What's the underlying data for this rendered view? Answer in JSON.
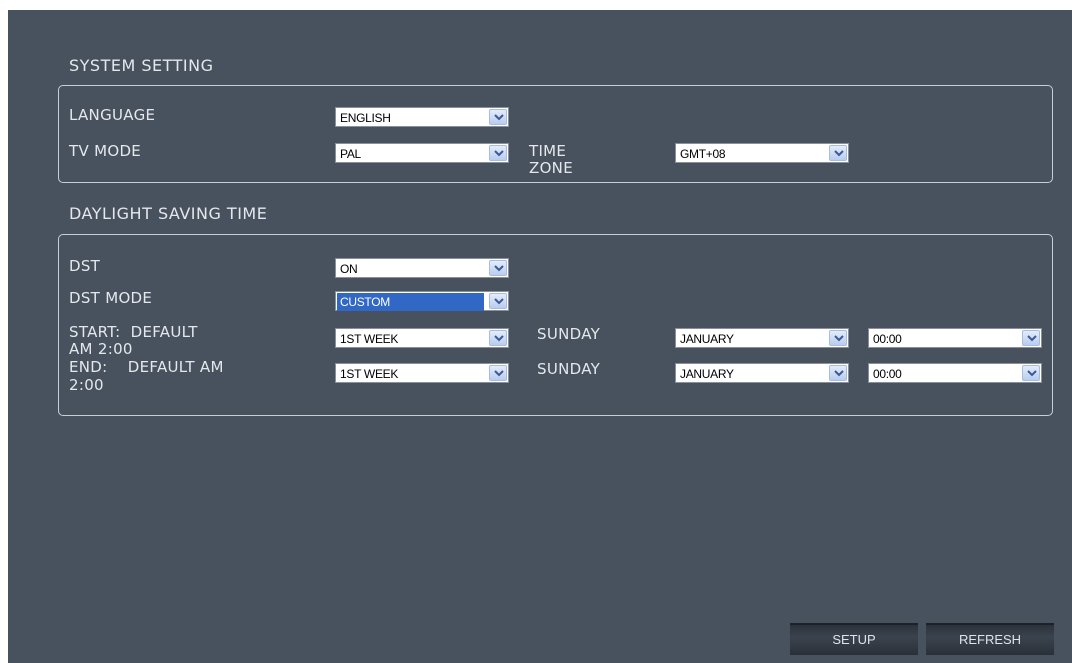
{
  "system": {
    "title": "SYSTEM SETTING",
    "language_label": "LANGUAGE",
    "language_value": "ENGLISH",
    "tv_mode_label": "TV MODE",
    "tv_mode_value": "PAL",
    "time_zone_label_1": "TIME",
    "time_zone_label_2": "ZONE",
    "time_zone_value": "GMT+08"
  },
  "dst": {
    "title": "DAYLIGHT SAVING TIME",
    "dst_label": "DST",
    "dst_value": "ON",
    "mode_label": "DST MODE",
    "mode_value": "CUSTOM",
    "start_label_1": "START:  DEFAULT",
    "start_label_2": "AM 2:00",
    "start_week": "1ST WEEK",
    "start_day": "SUNDAY",
    "start_month": "JANUARY",
    "start_time": "00:00",
    "end_label_1": "END:    DEFAULT AM",
    "end_label_2": "2:00",
    "end_week": "1ST WEEK",
    "end_day": "SUNDAY",
    "end_month": "JANUARY",
    "end_time": "00:00"
  },
  "buttons": {
    "setup": "SETUP",
    "refresh": "REFRESH"
  },
  "colors": {
    "background": "#48525e",
    "highlight": "#3167c5"
  }
}
